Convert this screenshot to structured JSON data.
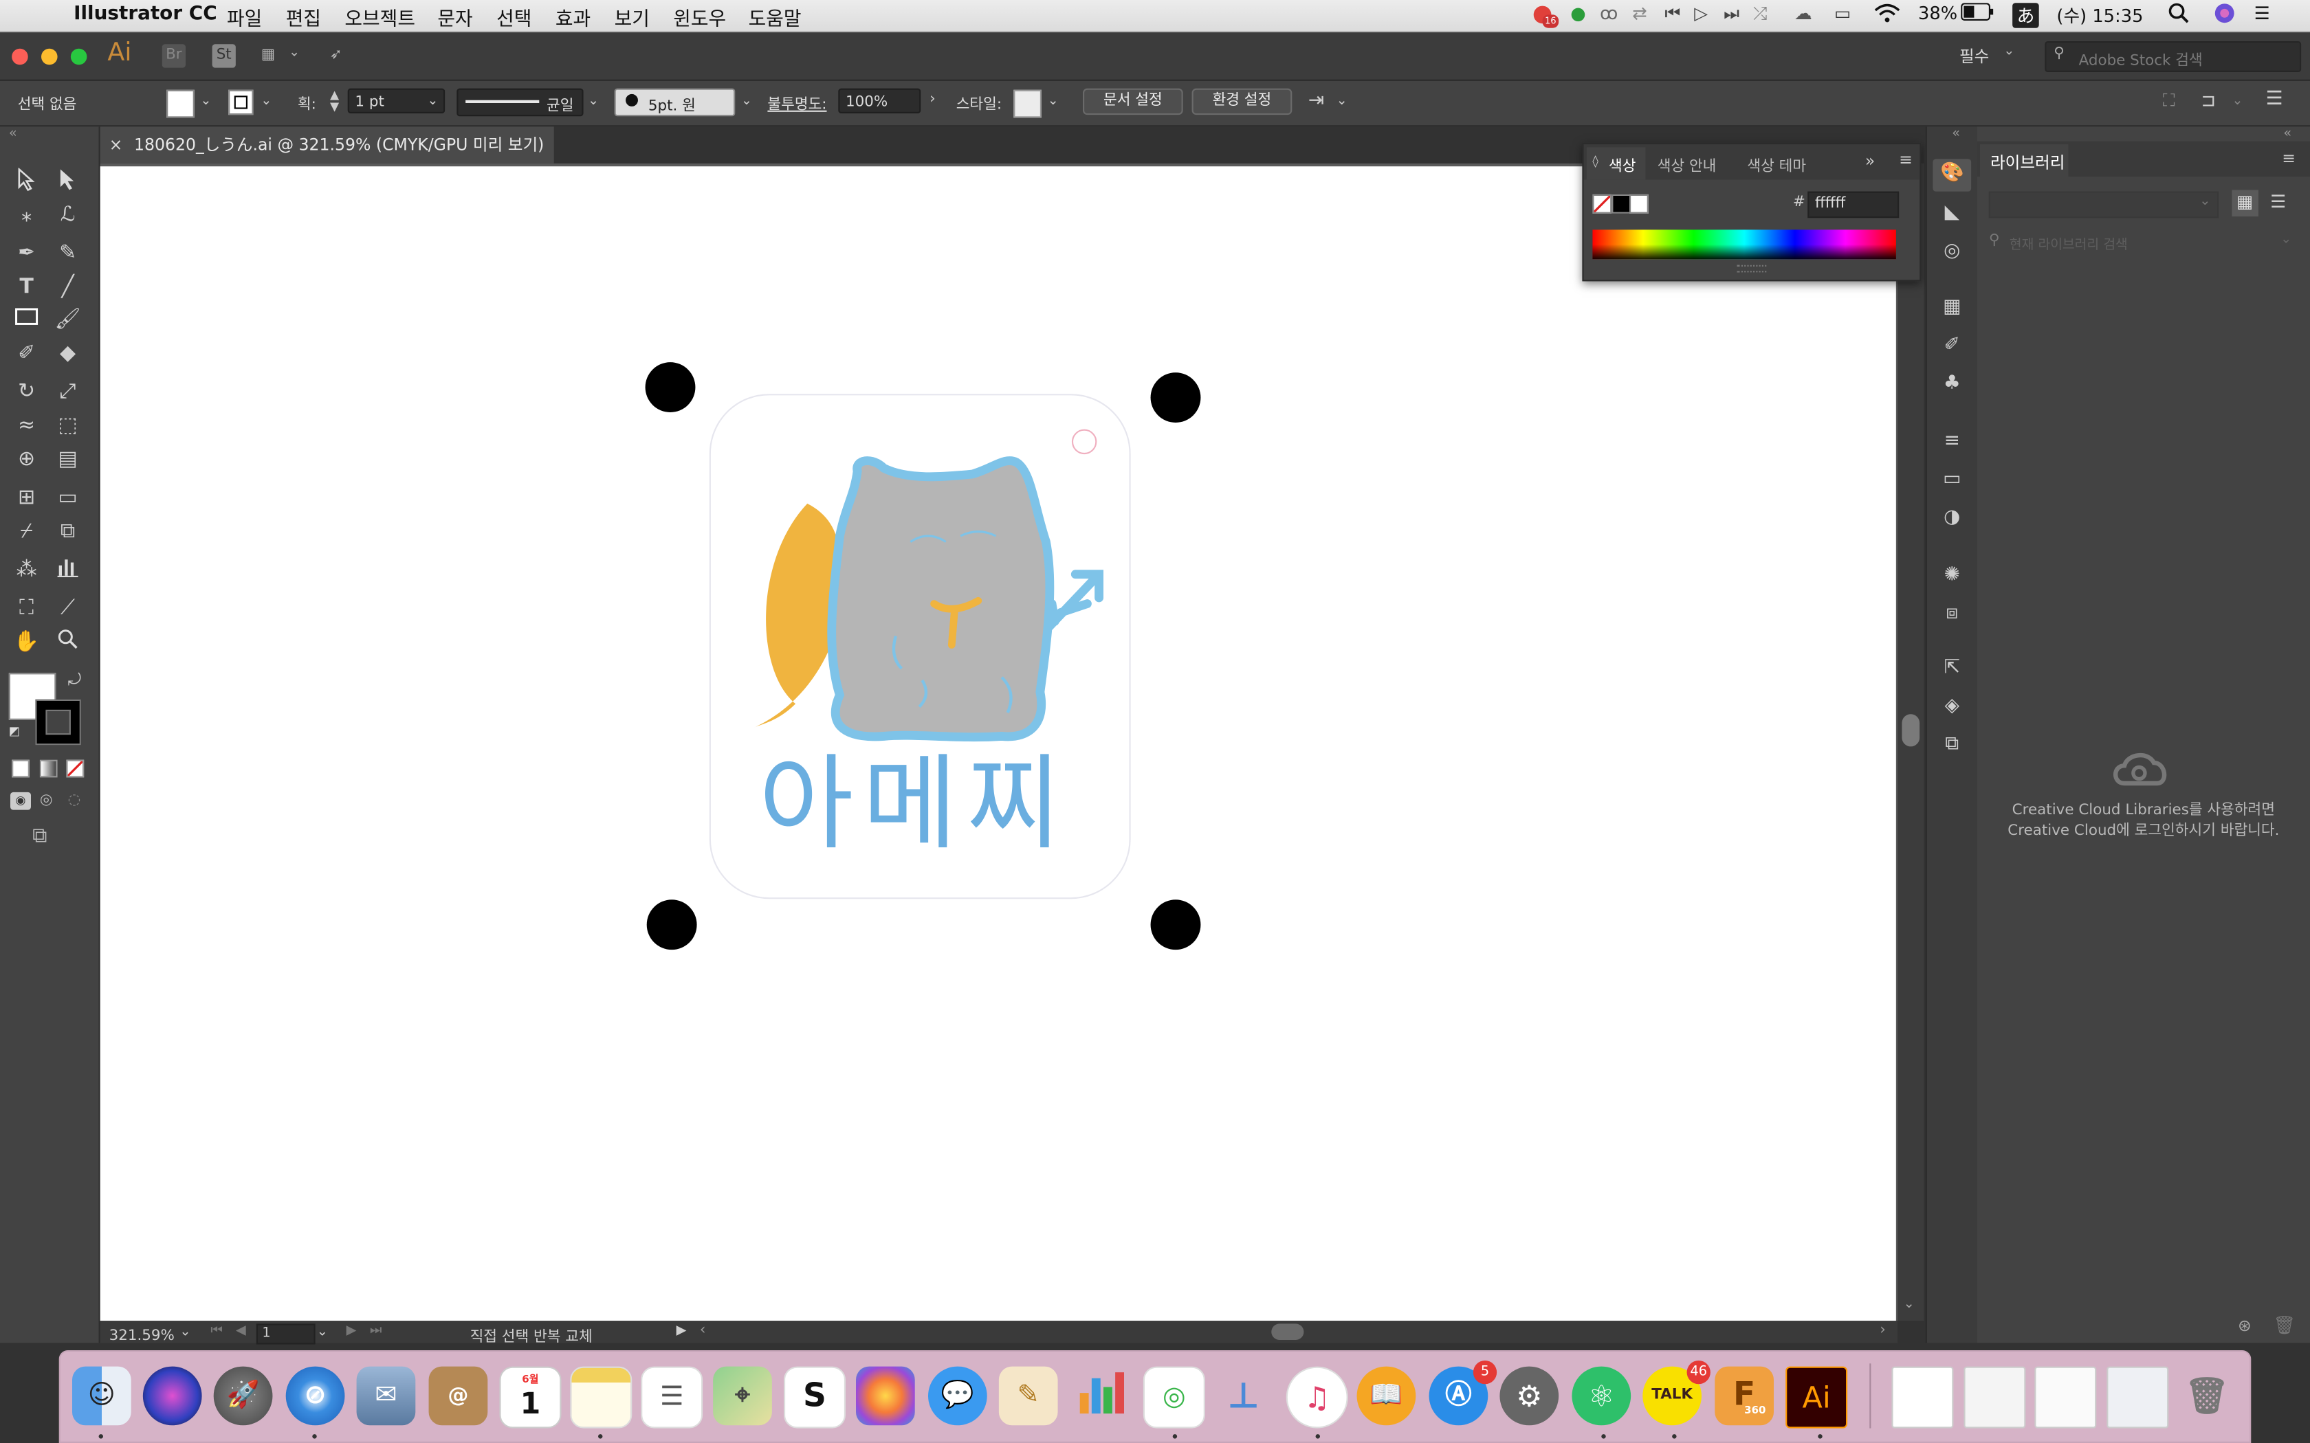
{
  "menubar": {
    "app_name": "Illustrator CC",
    "menus": [
      "파일",
      "편집",
      "오브젝트",
      "문자",
      "선택",
      "효과",
      "보기",
      "윈도우",
      "도움말"
    ],
    "battery": "38%",
    "clock": "(수) 15:35",
    "notification_badge": "16"
  },
  "titlebar": {
    "workspace": "필수",
    "stock_search_placeholder": "Adobe Stock 검색"
  },
  "control": {
    "selection": "선택 없음",
    "stroke_label": "획:",
    "stroke_weight": "1 pt",
    "stroke_profile": "균일",
    "brush": "5pt. 원",
    "opacity_label": "불투명도:",
    "opacity_value": "100%",
    "style_label": "스타일:",
    "doc_setup": "문서 설정",
    "preferences": "환경 설정"
  },
  "document": {
    "tab_title": "180620_しうん.ai @ 321.59% (CMYK/GPU 미리 보기)",
    "artwork_text": "아메찌"
  },
  "status": {
    "zoom": "321.59%",
    "artboard_num": "1",
    "tool_info": "직접 선택 반복 교체"
  },
  "color_panel": {
    "tabs": [
      "색상",
      "색상 안내",
      "색상 테마"
    ],
    "hex_label": "#",
    "hex_value": "ffffff"
  },
  "library": {
    "title": "라이브러리",
    "search_placeholder": "현재 라이브러리 검색",
    "message": "Creative Cloud Libraries를 사용하려면 Creative Cloud에 로그인하시기 바랍니다."
  },
  "dock": {
    "calendar_month": "6월",
    "calendar_day": "1",
    "app_store_badge": "5",
    "kakao_badge": "46",
    "kakao_label": "TALK",
    "ai_label": "Ai",
    "fusion_label": "360"
  },
  "colors": {
    "cat_fill": "#b5b5b5",
    "cat_outline": "#7ec3e8",
    "moon": "#f0b43f",
    "text_blue": "#6aaee0"
  }
}
